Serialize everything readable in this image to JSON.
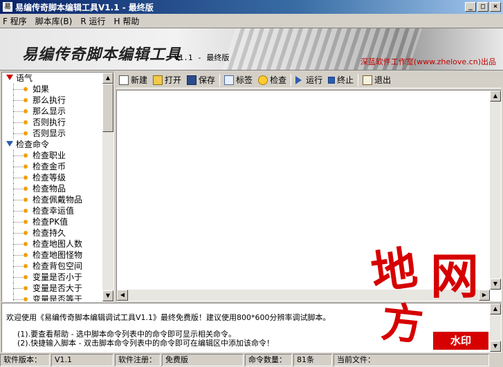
{
  "window": {
    "title": "易编传奇脚本编辑工具V1.1 - 最终版",
    "min_glyph": "_",
    "max_glyph": "□",
    "close_glyph": "×"
  },
  "menu": [
    {
      "label": "F 程序"
    },
    {
      "label": "脚本库(B)"
    },
    {
      "label": "R 运行"
    },
    {
      "label": "H 帮助"
    }
  ],
  "banner": {
    "title": "易编传奇脚本编辑工具",
    "version": "V1.1 - 最终版",
    "credit": "深蓝软件工作室(www.zhelove.cn)出品"
  },
  "tree": {
    "groups": [
      {
        "label": "语气",
        "color": "#cc0000",
        "items": [
          "如果",
          "那么执行",
          "那么显示",
          "否则执行",
          "否则显示"
        ]
      },
      {
        "label": "检查命令",
        "color": "#2a5db0",
        "items": [
          "检查职业",
          "检查金币",
          "检查等级",
          "检查物品",
          "检查佩戴物品",
          "检查幸运值",
          "检查PK值",
          "检查持久",
          "检查地图人数",
          "检查地图怪物",
          "检查背包空间",
          "变量是否小于",
          "变量是否大于",
          "变量是否等于"
        ]
      }
    ]
  },
  "toolbar": {
    "new": "新建",
    "open": "打开",
    "save": "保存",
    "tag": "标签",
    "check": "检查",
    "run": "运行",
    "stop": "终止",
    "exit": "退出"
  },
  "log": {
    "line1": "欢迎使用《易编传奇脚本编辑调试工具V1.1》最终免费版！建议使用800*600分辨率调试脚本。",
    "line2": "(1).要查看帮助 - 选中脚本命令列表中的命令即可显示相关命令。",
    "line3": "(2).快捷输入脚本 - 双击脚本命令列表中的命令即可在编辑区中添加该命令！"
  },
  "status": {
    "version_label": "软件版本：",
    "version_value": "V1.1",
    "reg_label": "软件注册：",
    "reg_value": "免费版",
    "count_label": "命令数量：",
    "count_value": "81条",
    "file_label": "当前文件："
  },
  "watermark": {
    "g1": "地",
    "g2": "网",
    "g3": "方",
    "seal": "水印"
  },
  "colors": {
    "titlebar": "#0a246a",
    "stamp": "#d60000",
    "credit": "#c00000"
  }
}
